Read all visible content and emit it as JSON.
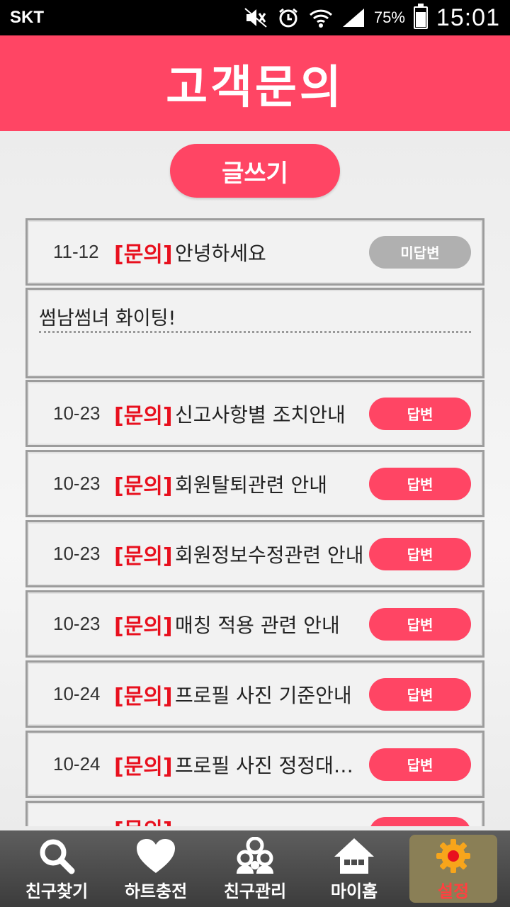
{
  "status_bar": {
    "carrier": "SKT",
    "battery_percent": "75%",
    "battery_level": 0.75,
    "time": "15:01"
  },
  "header": {
    "title": "고객문의"
  },
  "write_button": {
    "label": "글쓰기"
  },
  "inquiries": [
    {
      "date": "11-12",
      "tag": "[문의]",
      "title": "안녕하세요",
      "status": "미답변",
      "answered": false
    },
    {
      "date": "10-23",
      "tag": "[문의]",
      "title": "신고사항별 조치안내",
      "status": "답변",
      "answered": true
    },
    {
      "date": "10-23",
      "tag": "[문의]",
      "title": "회원탈퇴관련 안내",
      "status": "답변",
      "answered": true
    },
    {
      "date": "10-23",
      "tag": "[문의]",
      "title": "회원정보수정관련 안내",
      "status": "답변",
      "answered": true
    },
    {
      "date": "10-23",
      "tag": "[문의]",
      "title": "매칭 적용 관련 안내",
      "status": "답변",
      "answered": true
    },
    {
      "date": "10-24",
      "tag": "[문의]",
      "title": "프로필 사진 기준안내",
      "status": "답변",
      "answered": true
    },
    {
      "date": "10-24",
      "tag": "[문의]",
      "title": "프로필 사진 정정대상 …",
      "status": "답변",
      "answered": true
    },
    {
      "date": "",
      "tag": "[문의]",
      "title": "",
      "status": "",
      "answered": true
    }
  ],
  "expanded": {
    "content": "썸남썸녀 화이팅!"
  },
  "bottom_nav": {
    "items": [
      {
        "label": "친구찾기",
        "icon": "search-icon"
      },
      {
        "label": "하트충전",
        "icon": "heart-icon"
      },
      {
        "label": "친구관리",
        "icon": "friends-icon"
      },
      {
        "label": "마이홈",
        "icon": "home-icon"
      },
      {
        "label": "설정",
        "icon": "gear-icon",
        "active": true
      }
    ]
  },
  "colors": {
    "accent": "#ff4564",
    "tag_red": "#e8101e",
    "pending_gray": "#b0b0b0",
    "active_label": "#ff4040",
    "gear_orange": "#f7a51b"
  }
}
